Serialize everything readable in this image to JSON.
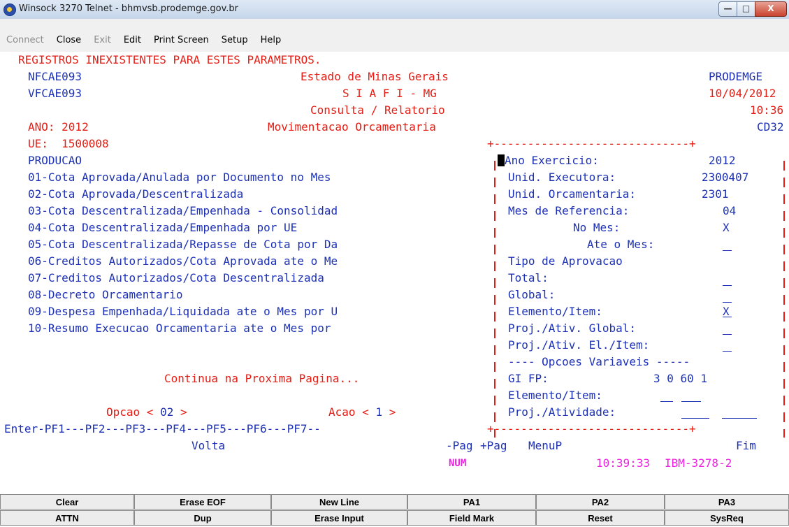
{
  "window": {
    "title": "Winsock 3270 Telnet - bhmvsb.prodemge.gov.br",
    "min_glyph": "—",
    "max_glyph": "□",
    "close_glyph": "X"
  },
  "menu": [
    "Connect",
    "Close",
    "Exit",
    "Edit",
    "Print Screen",
    "Setup",
    "Help"
  ],
  "screen": {
    "error": "REGISTROS INEXISTENTES PARA ESTES PARAMETROS.",
    "header": {
      "left1": "NFCAE093",
      "left2": "VFCAE093",
      "org": "Estado de Minas Gerais",
      "system": "S I A F I - MG",
      "mode": "Consulta / Relatorio",
      "function": "Movimentacao Orcamentaria",
      "right1": "PRODEMGE",
      "date": "10/04/2012",
      "time": "10:36",
      "screen_id": "CD32",
      "ano": "ANO: 2012",
      "ue": "UE:  1500008"
    },
    "menu_title": "PRODUCAO",
    "options": [
      "01-Cota Aprovada/Anulada por Documento no Mes",
      "02-Cota Aprovada/Descentralizada",
      "03-Cota Descentralizada/Empenhada - Consolidad",
      "04-Cota Descentralizada/Empenhada por UE",
      "05-Cota Descentralizada/Repasse de Cota por Da",
      "06-Creditos Autorizados/Cota Aprovada ate o Me",
      "07-Creditos Autorizados/Cota Descentralizada",
      "08-Decreto Orcamentario",
      "09-Despesa Empenhada/Liquidada ate o Mes por U",
      "10-Resumo Execucao Orcamentaria ate o Mes por"
    ],
    "continue_msg": "Continua na Proxima Pagina...",
    "opcao_label": "Opcao <",
    "opcao_value": "02",
    "acao_label": "Acao <",
    "acao_value": "1",
    "panel": {
      "border_top": "+-----------------------------+",
      "ano_exercicio_label": "Ano Exercicio:",
      "ano_exercicio_value": "2012",
      "unid_exec_label": "Unid. Executora:",
      "unid_exec_value": "2300407",
      "unid_orc_label": "Unid. Orcamentaria:",
      "unid_orc_value": "2301",
      "mes_ref_label": "Mes de Referencia:",
      "mes_ref_value": "04",
      "no_mes_label": "No Mes:",
      "no_mes_value": "X",
      "ate_mes_label": "Ate o Mes:",
      "tipo_aprov_label": "Tipo de Aprovacao",
      "total_label": "Total:",
      "global_label": "Global:",
      "elem_item_label": "Elemento/Item:",
      "elem_item_value": "X",
      "proj_global_label": "Proj./Ativ. Global:",
      "proj_el_label": "Proj./Ativ. El./Item:",
      "opcoes_var": "---- Opcoes Variaveis -----",
      "gi_fp_label": "GI FP:",
      "gi_fp_value": "3 0 60 1",
      "elem_item2_label": "Elemento/Item:",
      "proj_ativ_label": "Proj./Atividade:"
    },
    "pf_line": "Enter-PF1---PF2---PF3---PF4---PF5---PF6---PF7--",
    "pf_labels": {
      "volta": "Volta",
      "minus_pag": "-Pag",
      "plus_pag": "+Pag",
      "menup": "MenuP",
      "fim": "Fim"
    },
    "status": {
      "num": "NUM",
      "clock": "10:39:33",
      "model": "IBM-3278-2"
    }
  },
  "keys_row1": [
    "Clear",
    "Erase EOF",
    "New Line",
    "PA1",
    "PA2",
    "PA3"
  ],
  "keys_row2": [
    "ATTN",
    "Dup",
    "Erase Input",
    "Field Mark",
    "Reset",
    "SysReq"
  ]
}
